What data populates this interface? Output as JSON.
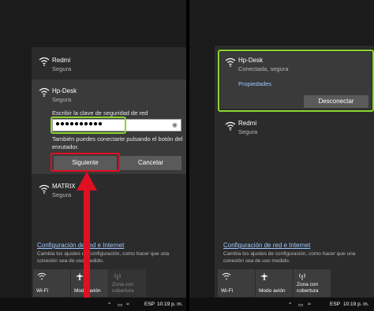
{
  "left": {
    "networks": [
      {
        "name": "Redmi",
        "status": "Segura"
      },
      {
        "name": "Hp-Desk",
        "status": "Segura"
      },
      {
        "name": "MATRIX",
        "status": "Segura"
      }
    ],
    "security_prompt": "Escribir la clave de seguridad de red",
    "password_value": "●●●●●●●●●●",
    "hint": "También puedes conectarte pulsando el botón del enrutador.",
    "next_button": "Siguiente",
    "cancel_button": "Cancelar",
    "settings_link": "Configuración de red e Internet",
    "settings_desc": "Cambia los ajustes de configuración, como hacer que una conexión sea de uso medido.",
    "tiles": [
      {
        "label": "Wi-Fi",
        "icon": "wifi-icon"
      },
      {
        "label": "Modo avión",
        "icon": "airplane-icon"
      },
      {
        "label": "Zona con cobertura",
        "icon": "hotspot-icon"
      }
    ],
    "taskbar": {
      "lang": "ESP",
      "time": "10:19 p. m."
    }
  },
  "right": {
    "connected": {
      "name": "Hp-Desk",
      "status": "Conectada, segura",
      "properties": "Propiedades",
      "disconnect": "Desconectar"
    },
    "networks": [
      {
        "name": "Redmi",
        "status": "Segura"
      }
    ],
    "settings_link": "Configuración de red e Internet",
    "settings_desc": "Cambia los ajustes de configuración, como hacer que una conexión sea de uso medido.",
    "tiles": [
      {
        "label": "Wi-Fi",
        "icon": "wifi-icon"
      },
      {
        "label": "Modo avión",
        "icon": "airplane-icon"
      },
      {
        "label": "Zona con cobertura",
        "icon": "hotspot-icon"
      }
    ],
    "taskbar": {
      "lang": "ESP",
      "time": "10:19 p. m."
    }
  },
  "colors": {
    "highlight_green": "#8bd631",
    "highlight_red": "#e01020",
    "link": "#9fc7ff"
  }
}
